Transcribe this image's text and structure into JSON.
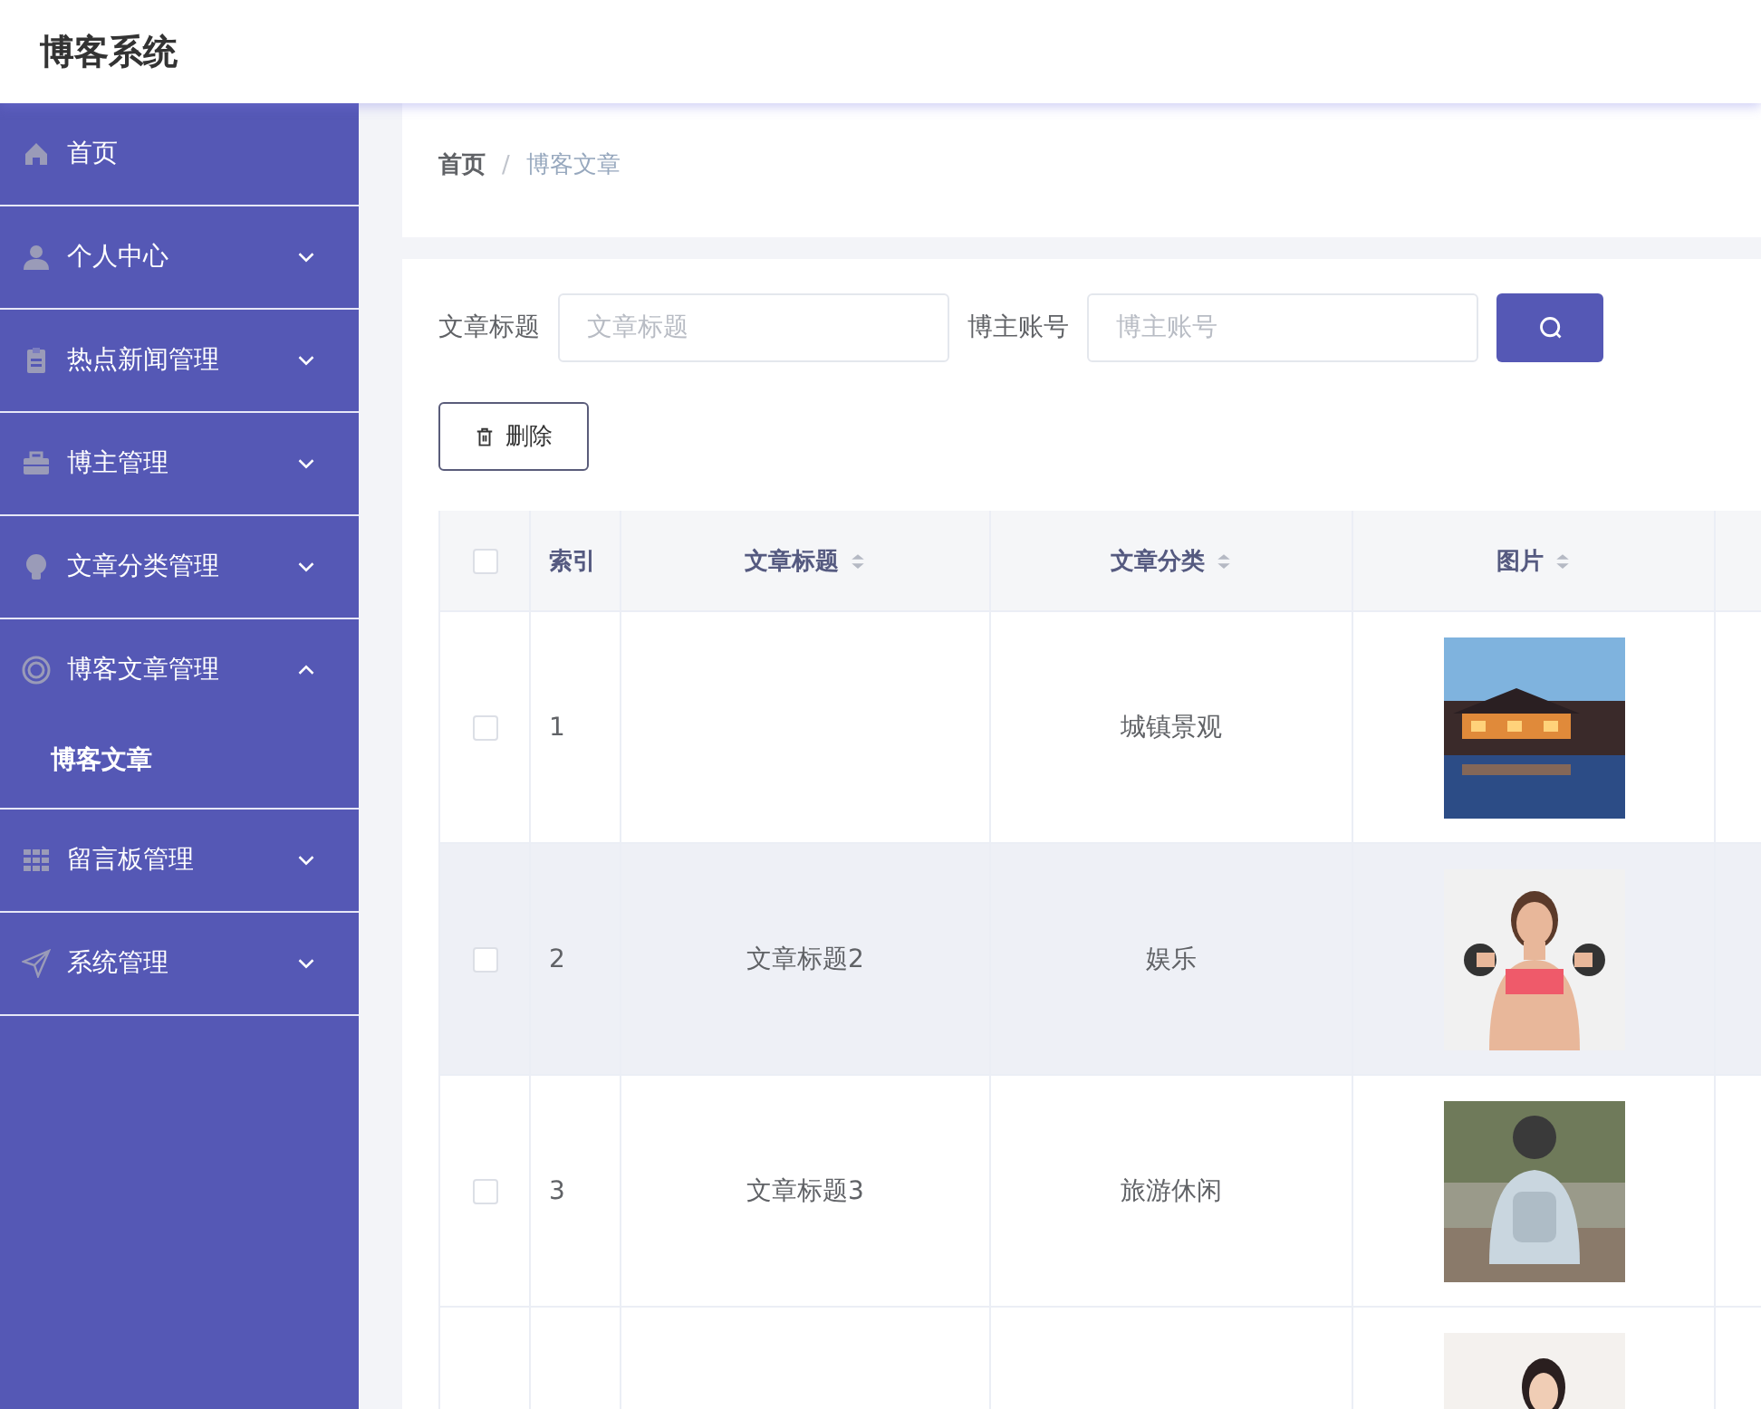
{
  "app_title": "博客系统",
  "sidebar": {
    "items": [
      {
        "label": "首页",
        "kind": "link"
      },
      {
        "label": "个人中心",
        "kind": "group",
        "expanded": false
      },
      {
        "label": "热点新闻管理",
        "kind": "group",
        "expanded": false
      },
      {
        "label": "博主管理",
        "kind": "group",
        "expanded": false
      },
      {
        "label": "文章分类管理",
        "kind": "group",
        "expanded": false
      },
      {
        "label": "博客文章管理",
        "kind": "group",
        "expanded": true,
        "children": [
          {
            "label": "博客文章",
            "selected": true
          }
        ]
      },
      {
        "label": "留言板管理",
        "kind": "group",
        "expanded": false
      },
      {
        "label": "系统管理",
        "kind": "group",
        "expanded": false
      }
    ]
  },
  "breadcrumb": [
    "首页",
    "博客文章"
  ],
  "breadcrumb_separator": "/",
  "search": {
    "fields": [
      {
        "label": "文章标题",
        "placeholder": "文章标题"
      },
      {
        "label": "博主账号",
        "placeholder": "博主账号"
      }
    ]
  },
  "delete_button": "删除",
  "table": {
    "columns": [
      {
        "kind": "check",
        "checked": false
      },
      {
        "label": "索引",
        "kind": "text"
      },
      {
        "label": "文章标题",
        "kind": "sort"
      },
      {
        "label": "文章分类",
        "kind": "sort"
      },
      {
        "label": "图片",
        "kind": "sort"
      }
    ],
    "rows": [
      {
        "checked": false,
        "highlighted": false,
        "index": "1",
        "category": "城镇景观"
      },
      {
        "checked": false,
        "highlighted": true,
        "index": "2",
        "title": "文章标题2",
        "category": "娱乐"
      },
      {
        "checked": false,
        "highlighted": false,
        "index": "3",
        "title": "文章标题3",
        "category": "旅游休闲"
      },
      {
        "highlighted": false
      }
    ]
  }
}
